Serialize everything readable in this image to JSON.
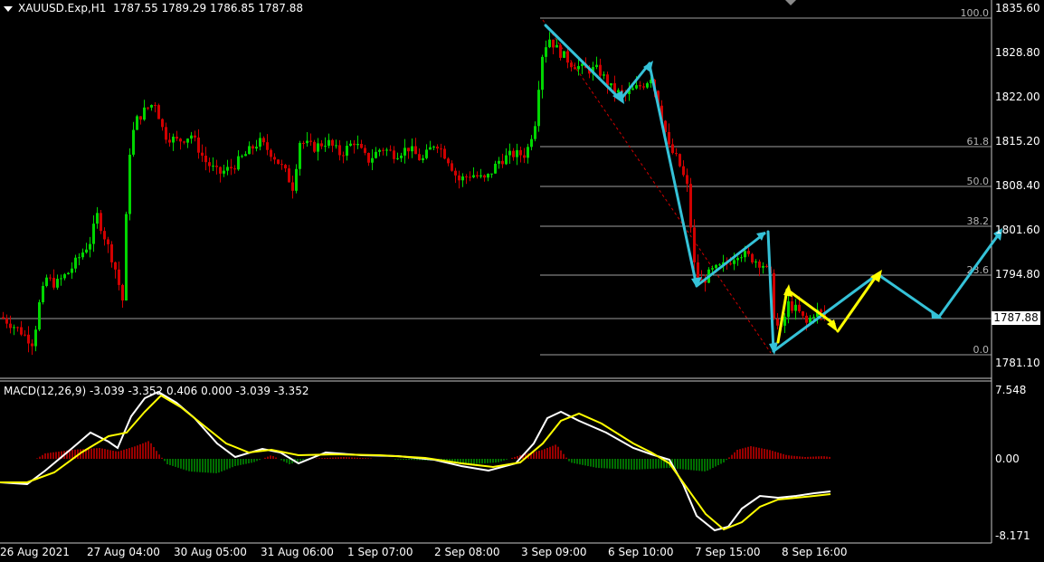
{
  "header": {
    "symbol": "XAUUSD.Exp,H1",
    "ohlc": "1787.55 1789.29 1786.85 1787.88"
  },
  "macd": {
    "label": "MACD(12,26,9) -3.039 -3.352 0.406 0.000 -3.039 -3.352",
    "axis_labels": [
      "7.548",
      "0.00",
      "-8.171"
    ]
  },
  "price_axis": [
    "1835.60",
    "1828.80",
    "1822.00",
    "1815.20",
    "1808.40",
    "1801.60",
    "1794.80",
    "1781.10"
  ],
  "current_price": "1787.88",
  "fib_levels": [
    "100.0",
    "61.8",
    "50.0",
    "38.2",
    "23.6",
    "0.0"
  ],
  "time_axis": [
    "26 Aug 2021",
    "27 Aug 04:00",
    "30 Aug 05:00",
    "31 Aug 06:00",
    "1 Sep 07:00",
    "2 Sep 08:00",
    "3 Sep 09:00",
    "6 Sep 10:00",
    "7 Sep 15:00",
    "8 Sep 16:00"
  ],
  "colors": {
    "bull_candle": "#00d600",
    "bear_candle": "#d00000",
    "cyan_arrows": "#35c2d8",
    "yellow_arrows": "#ffff00",
    "macd_line": "#ffffff",
    "signal_line": "#ffff00"
  }
}
